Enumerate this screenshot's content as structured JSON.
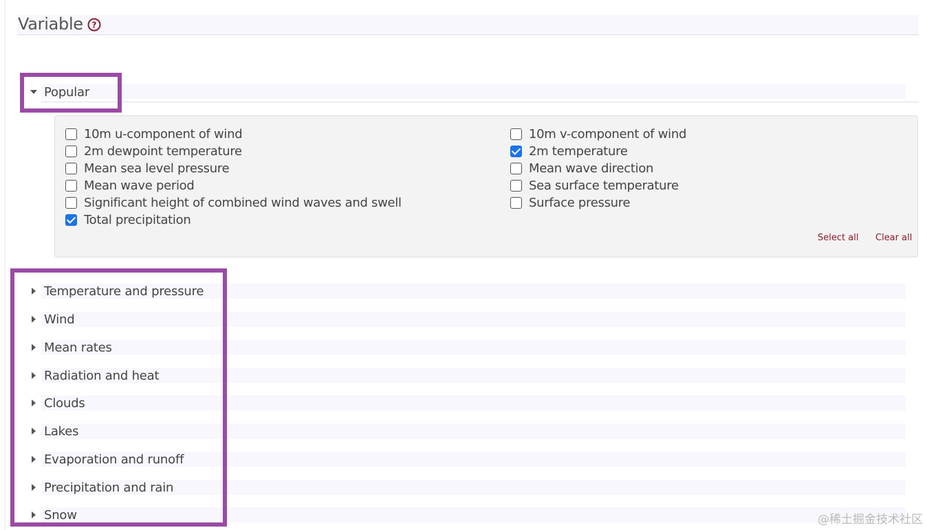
{
  "header": {
    "title": "Variable",
    "help_icon": "question-circle-icon"
  },
  "popular": {
    "label": "Popular",
    "expanded": true,
    "options_left": [
      {
        "label": "10m u-component of wind",
        "checked": false
      },
      {
        "label": "2m dewpoint temperature",
        "checked": false
      },
      {
        "label": "Mean sea level pressure",
        "checked": false
      },
      {
        "label": "Mean wave period",
        "checked": false
      },
      {
        "label": "Significant height of combined wind waves and swell",
        "checked": false
      },
      {
        "label": "Total precipitation",
        "checked": true
      }
    ],
    "options_right": [
      {
        "label": "10m v-component of wind",
        "checked": false
      },
      {
        "label": "2m temperature",
        "checked": true
      },
      {
        "label": "Mean wave direction",
        "checked": false
      },
      {
        "label": "Sea surface temperature",
        "checked": false
      },
      {
        "label": "Surface pressure",
        "checked": false
      }
    ],
    "select_all": "Select all",
    "clear_all": "Clear all"
  },
  "sections": [
    {
      "label": "Temperature and pressure"
    },
    {
      "label": "Wind"
    },
    {
      "label": "Mean rates"
    },
    {
      "label": "Radiation and heat"
    },
    {
      "label": "Clouds"
    },
    {
      "label": "Lakes"
    },
    {
      "label": "Evaporation and runoff"
    },
    {
      "label": "Precipitation and rain"
    },
    {
      "label": "Snow"
    }
  ],
  "watermark": "@稀土掘金技术社区",
  "colors": {
    "accent_link": "#8b1a2b",
    "highlight": "#9b4aa5",
    "checkbox_checked": "#1a73e8",
    "help_icon": "#8b1a2b"
  }
}
